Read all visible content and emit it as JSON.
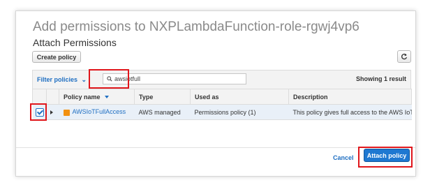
{
  "dialog": {
    "title": "Add permissions to NXPLambdaFunction-role-rgwj4vp6",
    "subtitle": "Attach Permissions"
  },
  "toolbar": {
    "create_policy_label": "Create policy",
    "refresh_icon": "refresh-icon",
    "filter_label": "Filter policies",
    "search_value": "awsiotfull",
    "showing_text": "Showing 1 result"
  },
  "table": {
    "columns": [
      "Policy name",
      "Type",
      "Used as",
      "Description"
    ],
    "rows": [
      {
        "checked": true,
        "policy_name": "AWSIoTFullAccess",
        "type": "AWS managed",
        "used_as": "Permissions policy (1)",
        "description": "This policy gives full access to the AWS IoT ..."
      }
    ]
  },
  "footer": {
    "cancel_label": "Cancel",
    "attach_label": "Attach policy"
  },
  "colors": {
    "accent": "#1f6fc2",
    "primary_button": "#1f78d1",
    "highlight": "#e0161b",
    "selected_row": "#e9f0f8"
  }
}
